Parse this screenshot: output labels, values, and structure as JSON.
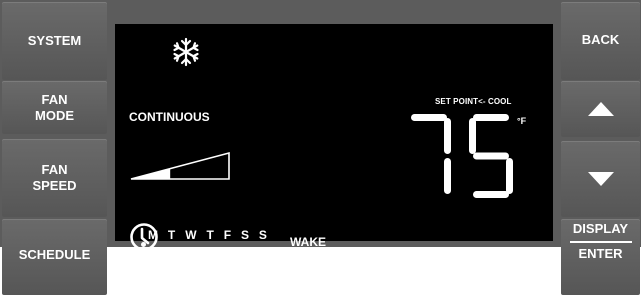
{
  "left_buttons": {
    "system": "SYSTEM",
    "fan_mode": [
      "FAN",
      "MODE"
    ],
    "fan_speed": [
      "FAN",
      "SPEED"
    ],
    "schedule": "SCHEDULE"
  },
  "right_buttons": {
    "back": "BACK",
    "up_icon": "triangle-up",
    "down_icon": "triangle-down",
    "display": "DISPLAY",
    "enter": "ENTER"
  },
  "display": {
    "mode_icon": "snowflake",
    "fan_mode_value": "CONTINUOUS",
    "setpoint_label": "SET POINT<- COOL",
    "temperature": "75",
    "unit": "°F",
    "fan_speed_level": 0.4,
    "days": "MTWTFSS",
    "active_day": "M",
    "schedule_period": "WAKE",
    "clock_icon": "clock"
  },
  "colors": {
    "panel": "#5c5c5c",
    "lcd_background": "#000000",
    "lcd_foreground": "#ffffff"
  }
}
